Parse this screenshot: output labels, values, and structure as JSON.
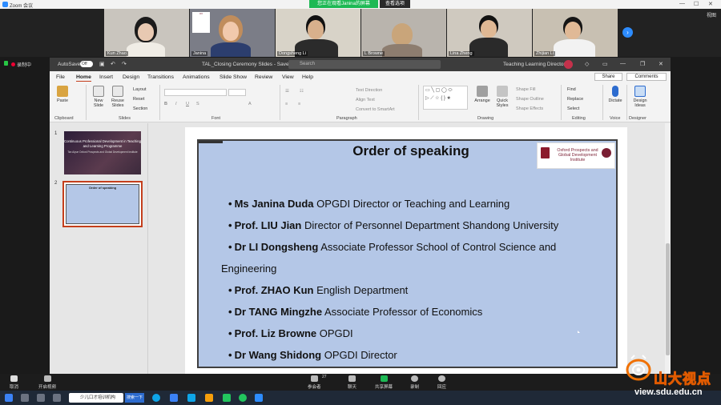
{
  "zoom": {
    "window_title": "Zoom 会议",
    "share_banner": "您正在观看Janina的屏幕",
    "view_options": "查看选项",
    "strip_view_label": "视图",
    "recording_label": "录制中",
    "participants": [
      {
        "name": "Kun Zhao"
      },
      {
        "name": "Janina"
      },
      {
        "name": "Dongsheng Li"
      },
      {
        "name": "L Browne"
      },
      {
        "name": "Lina Zheng"
      },
      {
        "name": "Zhijian Li"
      }
    ],
    "toolbar": {
      "mute": "取消",
      "video": "开启视频",
      "participants": "参会者",
      "participant_count": "27",
      "chat": "聊天",
      "share": "共享屏幕",
      "record": "录制",
      "reactions": "回应"
    }
  },
  "powerpoint": {
    "autosave_label": "AutoSave",
    "autosave_state": "Off",
    "file_name": "TAL_Closing Ceremony Slides - Saved",
    "search_placeholder": "Search",
    "user_name": "Teaching Learning Director",
    "menu": [
      "File",
      "Home",
      "Insert",
      "Design",
      "Transitions",
      "Animations",
      "Slide Show",
      "Review",
      "View",
      "Help"
    ],
    "active_menu": "Home",
    "share_label": "Share",
    "comments_label": "Comments",
    "ribbon": {
      "paste": "Paste",
      "clipboard_group": "Clipboard",
      "new_slide": "New Slide",
      "reuse_slides": "Reuse Slides",
      "layout": "Layout",
      "reset": "Reset",
      "section": "Section",
      "slides_group": "Slides",
      "font_group": "Font",
      "text_direction": "Text Direction",
      "align_text": "Align Text",
      "convert_smartart": "Convert to SmartArt",
      "paragraph_group": "Paragraph",
      "arrange": "Arrange",
      "quick_styles": "Quick Styles",
      "shape_fill": "Shape Fill",
      "shape_outline": "Shape Outline",
      "shape_effects": "Shape Effects",
      "drawing_group": "Drawing",
      "find": "Find",
      "replace": "Replace",
      "select": "Select",
      "editing_group": "Editing",
      "dictate": "Dictate",
      "voice_group": "Voice",
      "design_ideas": "Design Ideas",
      "designer_group": "Designer"
    },
    "thumbnails": [
      {
        "number": "1",
        "title": "Continuous Professional Development in Teaching and Learning Programme",
        "subtitle": "Tan Aiyue Oxford Prospects and Global Development Institute"
      },
      {
        "number": "2",
        "title": "Order of speaking"
      }
    ],
    "slide": {
      "title": "Order of speaking",
      "logo_text": "Oxford Prospects and Global Development Institute",
      "speakers": [
        {
          "name": "Ms Janina Duda",
          "role": "OPGDI Director or Teaching and Learning"
        },
        {
          "name": "Prof. LIU Jian",
          "role": "Director of Personnel Department Shandong University"
        },
        {
          "name": "Dr LI Dongsheng",
          "role": "Associate Professor School of Control Science and Engineering"
        },
        {
          "name": "Prof. ZHAO Kun",
          "role": "English Department"
        },
        {
          "name": "Dr TANG Mingzhe",
          "role": "Associate Professor of Economics"
        },
        {
          "name": "Prof. Liz Browne",
          "role": "OPGDI"
        },
        {
          "name": "Dr Wang Shidong",
          "role": "OPGDI Director"
        }
      ]
    }
  },
  "taskbar": {
    "search_text": "少儿口才培训机构",
    "search_button": "搜索一下"
  },
  "watermark": {
    "cn_text": "山大视点",
    "url": "view.sdu.edu.cn"
  },
  "colors": {
    "slide_bg": "#b4c7e7",
    "ppt_accent": "#c43e1c",
    "zoom_blue": "#2d8cff",
    "zoom_green": "#1db954"
  }
}
